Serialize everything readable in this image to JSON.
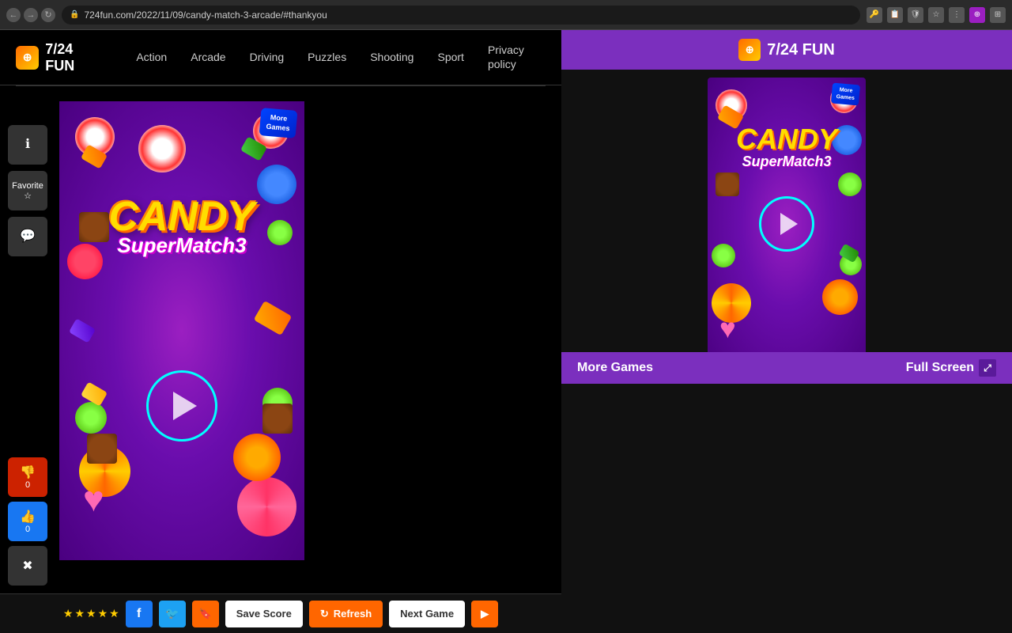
{
  "browser": {
    "url": "724fun.com/2022/11/09/candy-match-3-arcade/#thankyou",
    "full_url": "724fun.com/2022/11/09/candy-match-3-arcade/#thankyou"
  },
  "site": {
    "logo_text": "7/24 FUN",
    "nav": {
      "action": "Action",
      "arcade": "Arcade",
      "driving": "Driving",
      "puzzles": "Puzzles",
      "shooting": "Shooting",
      "sport": "Sport",
      "privacy": "Privacy policy"
    }
  },
  "sidebar": {
    "info_icon": "ℹ",
    "favorite_label": "Favorite",
    "favorite_icon": "☆",
    "comment_icon": "💬"
  },
  "game": {
    "title": "CANDY",
    "subtitle": "SuperMatch3",
    "more_games": "More\nGames"
  },
  "voting": {
    "dislike_count": "0",
    "like_count": "0"
  },
  "toolbar": {
    "stars": [
      "★",
      "★",
      "★",
      "★",
      "★"
    ],
    "save_score": "Save Score",
    "refresh": "Refresh",
    "next_game": "Next Game"
  },
  "ad": {
    "title": "7/24 FUN",
    "game_title": "CANDY",
    "game_subtitle": "SuperMatch3",
    "more_games_label": "More Games",
    "fullscreen_label": "Full Screen"
  }
}
